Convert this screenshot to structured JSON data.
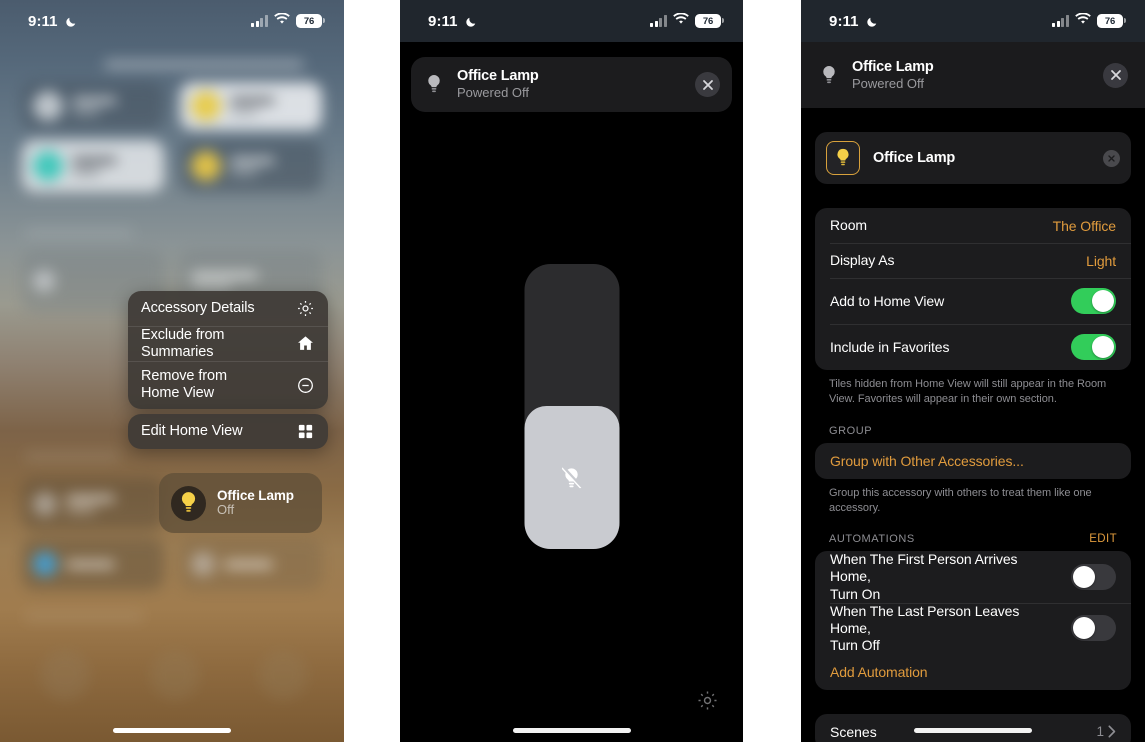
{
  "status_bar": {
    "time": "9:11",
    "dnd_icon": "crescent-moon-icon",
    "signal_icon": "cellular-bars-icon",
    "wifi_icon": "wifi-icon",
    "battery_level": "76"
  },
  "panel_1": {
    "name": "home-app-context-menu-screen",
    "context_menu": {
      "groups": [
        {
          "items": [
            {
              "label": "Accessory Details",
              "icon": "gear-icon"
            },
            {
              "label": "Exclude from Summaries",
              "icon": "house-icon"
            },
            {
              "label": "Remove from\nHome View",
              "line1": "Remove from",
              "line2": "Home View",
              "icon": "minus-circle-icon"
            }
          ]
        },
        {
          "items": [
            {
              "label": "Edit Home View",
              "icon": "grid-squares-icon"
            }
          ]
        }
      ]
    },
    "accessory_tile": {
      "icon": "lightbulb-icon",
      "name": "Office Lamp",
      "state": "Off"
    }
  },
  "panel_2": {
    "name": "accessory-control-screen",
    "header": {
      "icon": "lightbulb-icon",
      "title": "Office Lamp",
      "subtitle": "Powered Off",
      "close_icon": "close-icon"
    },
    "brightness_slider": {
      "icon": "lightbulb-slash-icon",
      "fill_percent": 50
    },
    "settings_icon": "gear-icon"
  },
  "panel_3": {
    "name": "accessory-settings-screen",
    "header": {
      "icon": "lightbulb-icon",
      "title": "Office Lamp",
      "subtitle": "Powered Off",
      "close_icon": "close-icon"
    },
    "name_field": {
      "icon": "lightbulb-icon",
      "value": "Office Lamp",
      "clear_icon": "clear-circle-icon"
    },
    "settings": [
      {
        "key": "Room",
        "value": "The Office",
        "type": "value"
      },
      {
        "key": "Display As",
        "value": "Light",
        "type": "value"
      },
      {
        "key": "Add to Home View",
        "toggle": "on",
        "type": "toggle"
      },
      {
        "key": "Include in Favorites",
        "toggle": "on",
        "type": "toggle"
      }
    ],
    "settings_footnote": "Tiles hidden from Home View will still appear in the Room View. Favorites will appear in their own section.",
    "group_section": {
      "header": "GROUP",
      "action": "Group with Other Accessories...",
      "footnote": "Group this accessory with others to treat them like one accessory."
    },
    "automations_section": {
      "header": "AUTOMATIONS",
      "edit_label": "EDIT",
      "items": [
        {
          "line1": "When The First Person Arrives Home,",
          "line2": "Turn On",
          "toggle": "off"
        },
        {
          "line1": "When The Last Person Leaves Home,",
          "line2": "Turn Off",
          "toggle": "off"
        }
      ],
      "add_label": "Add Automation"
    },
    "scenes_row": {
      "label": "Scenes",
      "count": "1",
      "chevron_icon": "chevron-right-icon"
    }
  },
  "colors": {
    "accent_orange": "#e09b3d",
    "toggle_on_green": "#32cd5a",
    "card_background": "#1c1c1e",
    "screen_background": "#000000"
  }
}
